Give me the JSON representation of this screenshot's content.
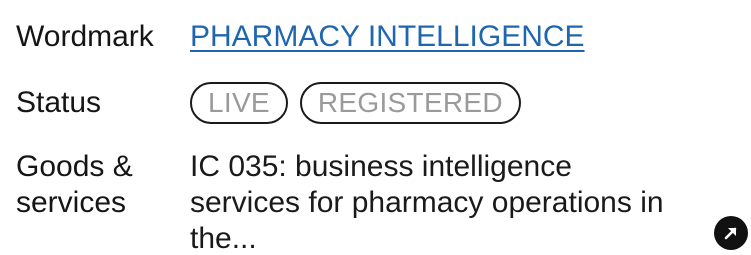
{
  "wordmark": {
    "label": "Wordmark",
    "value": "PHARMACY INTELLIGENCE"
  },
  "status": {
    "label": "Status",
    "badges": [
      "LIVE",
      "REGISTERED"
    ]
  },
  "goods_services": {
    "label_line1": "Goods &",
    "label_line2": "services",
    "text": "IC 035: business intelligence services for pharmacy operations in the..."
  },
  "open_button": {
    "icon": "arrow-up-right-icon",
    "color": "#111111"
  },
  "colors": {
    "link": "#1f66b0",
    "badge_text": "#9a9a9a",
    "badge_border": "#1a1a1a"
  }
}
